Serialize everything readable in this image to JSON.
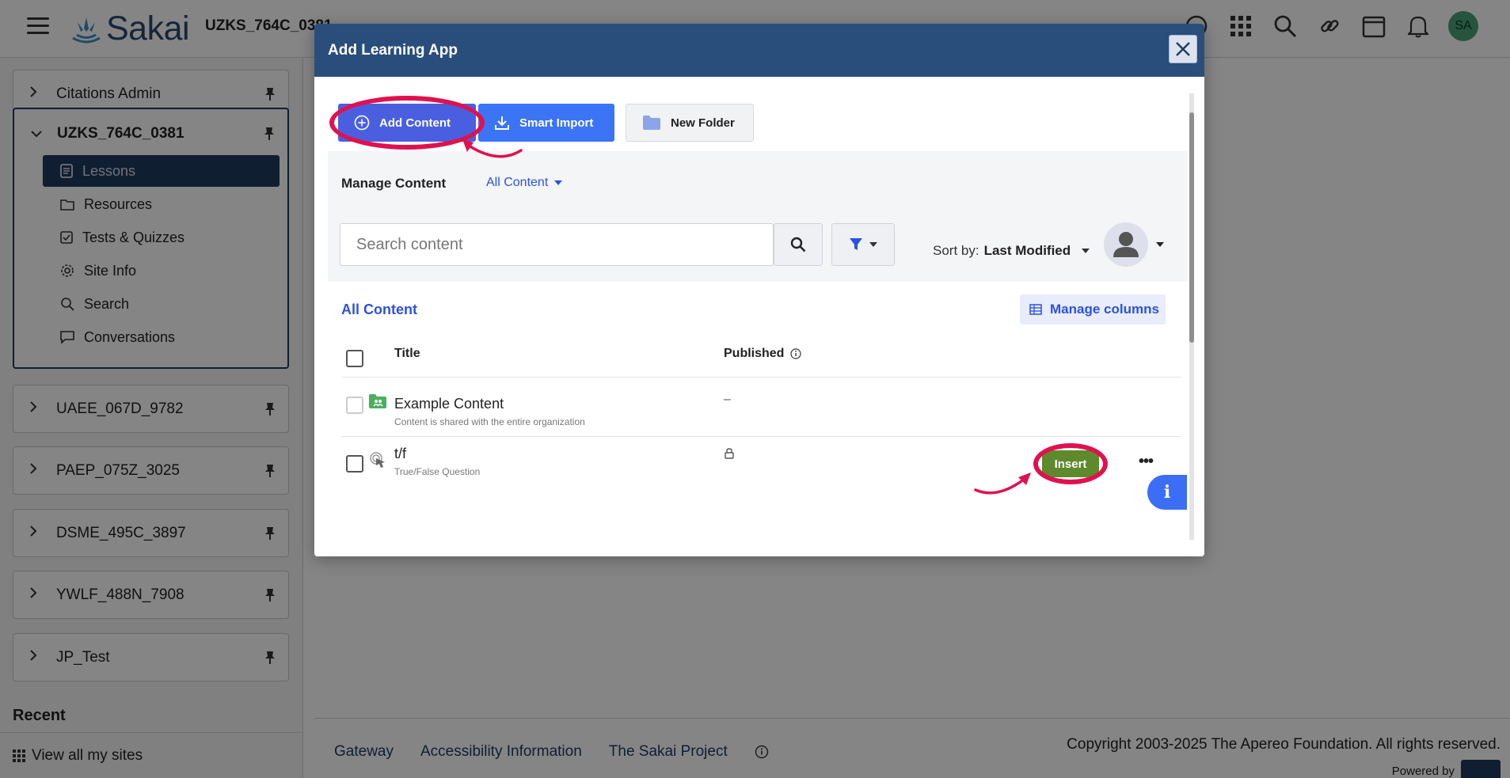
{
  "header": {
    "logo_text": "Sakai",
    "site_title": "UZKS_764C_0381",
    "avatar_initials": "SA"
  },
  "sidebar": {
    "sites": [
      {
        "label": "Citations Admin"
      },
      {
        "label": "UZKS_764C_0381"
      },
      {
        "label": "UAEE_067D_9782"
      },
      {
        "label": "PAEP_075Z_3025"
      },
      {
        "label": "DSME_495C_3897"
      },
      {
        "label": "YWLF_488N_7908"
      },
      {
        "label": "JP_Test"
      }
    ],
    "tools": [
      {
        "label": "Lessons",
        "icon": "page-icon",
        "active": true
      },
      {
        "label": "Resources",
        "icon": "folder-icon"
      },
      {
        "label": "Tests & Quizzes",
        "icon": "checkbox-icon"
      },
      {
        "label": "Site Info",
        "icon": "gear-icon"
      },
      {
        "label": "Search",
        "icon": "search-icon"
      },
      {
        "label": "Conversations",
        "icon": "chat-icon"
      }
    ],
    "recent_label": "Recent",
    "view_all_label": "View all my sites"
  },
  "footer": {
    "links": [
      "Gateway",
      "Accessibility Information",
      "The Sakai Project"
    ],
    "copyright": "Copyright 2003-2025 The Apereo Foundation. All rights reserved.",
    "powered_by": "Powered by"
  },
  "modal": {
    "title": "Add Learning App",
    "toolbar": {
      "add_content": "Add Content",
      "smart_import": "Smart Import",
      "new_folder": "New Folder"
    },
    "manage_content_label": "Manage Content",
    "content_filter_value": "All Content",
    "search": {
      "placeholder": "Search content",
      "value": ""
    },
    "sort_label": "Sort by:",
    "sort_value": "Last Modified",
    "section_title": "All Content",
    "manage_columns": "Manage columns",
    "columns": {
      "title": "Title",
      "published": "Published"
    },
    "rows": [
      {
        "title": "Example Content",
        "subtitle": "Content is shared with the entire organization",
        "published": "–",
        "icon": "shared-folder-icon"
      },
      {
        "title": "t/f",
        "subtitle": "True/False Question",
        "published": "lock",
        "icon": "touch-icon",
        "action": "Insert"
      }
    ],
    "more_label": "•••",
    "info_label": "i"
  },
  "colors": {
    "header_blue": "#2a4e7b",
    "primary_indigo": "#4a5fe0",
    "smart_blue": "#3b74f5",
    "link_blue": "#2d52e0",
    "insert_green": "#5e8a2d",
    "highlight_ring": "#e0114f"
  }
}
